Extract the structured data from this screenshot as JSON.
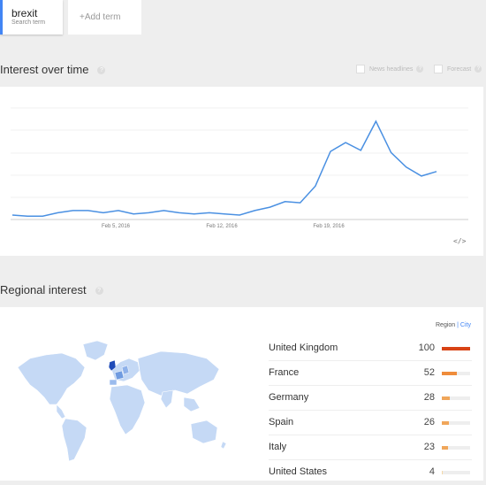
{
  "search": {
    "term": "brexit",
    "term_type": "Search term",
    "add_label": "+Add term",
    "accent": "#4285f4"
  },
  "interest": {
    "title": "Interest over time",
    "help_icon": "question-icon",
    "news_headlines": "News headlines",
    "forecast": "Forecast",
    "embed_icon": "</>"
  },
  "chart_data": {
    "type": "line",
    "title": "Interest over time",
    "xlabel": "",
    "ylabel": "",
    "x_tick_labels": [
      "Feb 5, 2016",
      "Feb 12, 2016",
      "Feb 19, 2016"
    ],
    "ylim": [
      0,
      100
    ],
    "grid": true,
    "color": "#4a90e2",
    "values": [
      4,
      3,
      3,
      6,
      8,
      8,
      6,
      8,
      5,
      6,
      8,
      6,
      5,
      6,
      5,
      4,
      8,
      11,
      16,
      15,
      30,
      61,
      69,
      62,
      88,
      60,
      47,
      39,
      43
    ]
  },
  "regional": {
    "title": "Regional interest",
    "toggle_region": "Region",
    "toggle_city": "City",
    "rows": [
      {
        "name": "United Kingdom",
        "value": "100",
        "pct": 1.0,
        "color": "#d84315"
      },
      {
        "name": "France",
        "value": "52",
        "pct": 0.52,
        "color": "#ef8c3b"
      },
      {
        "name": "Germany",
        "value": "28",
        "pct": 0.28,
        "color": "#f0a65a"
      },
      {
        "name": "Spain",
        "value": "26",
        "pct": 0.26,
        "color": "#f0a65a"
      },
      {
        "name": "Italy",
        "value": "23",
        "pct": 0.23,
        "color": "#f0a65a"
      },
      {
        "name": "United States",
        "value": "4",
        "pct": 0.04,
        "color": "#f5d9a8"
      }
    ]
  }
}
